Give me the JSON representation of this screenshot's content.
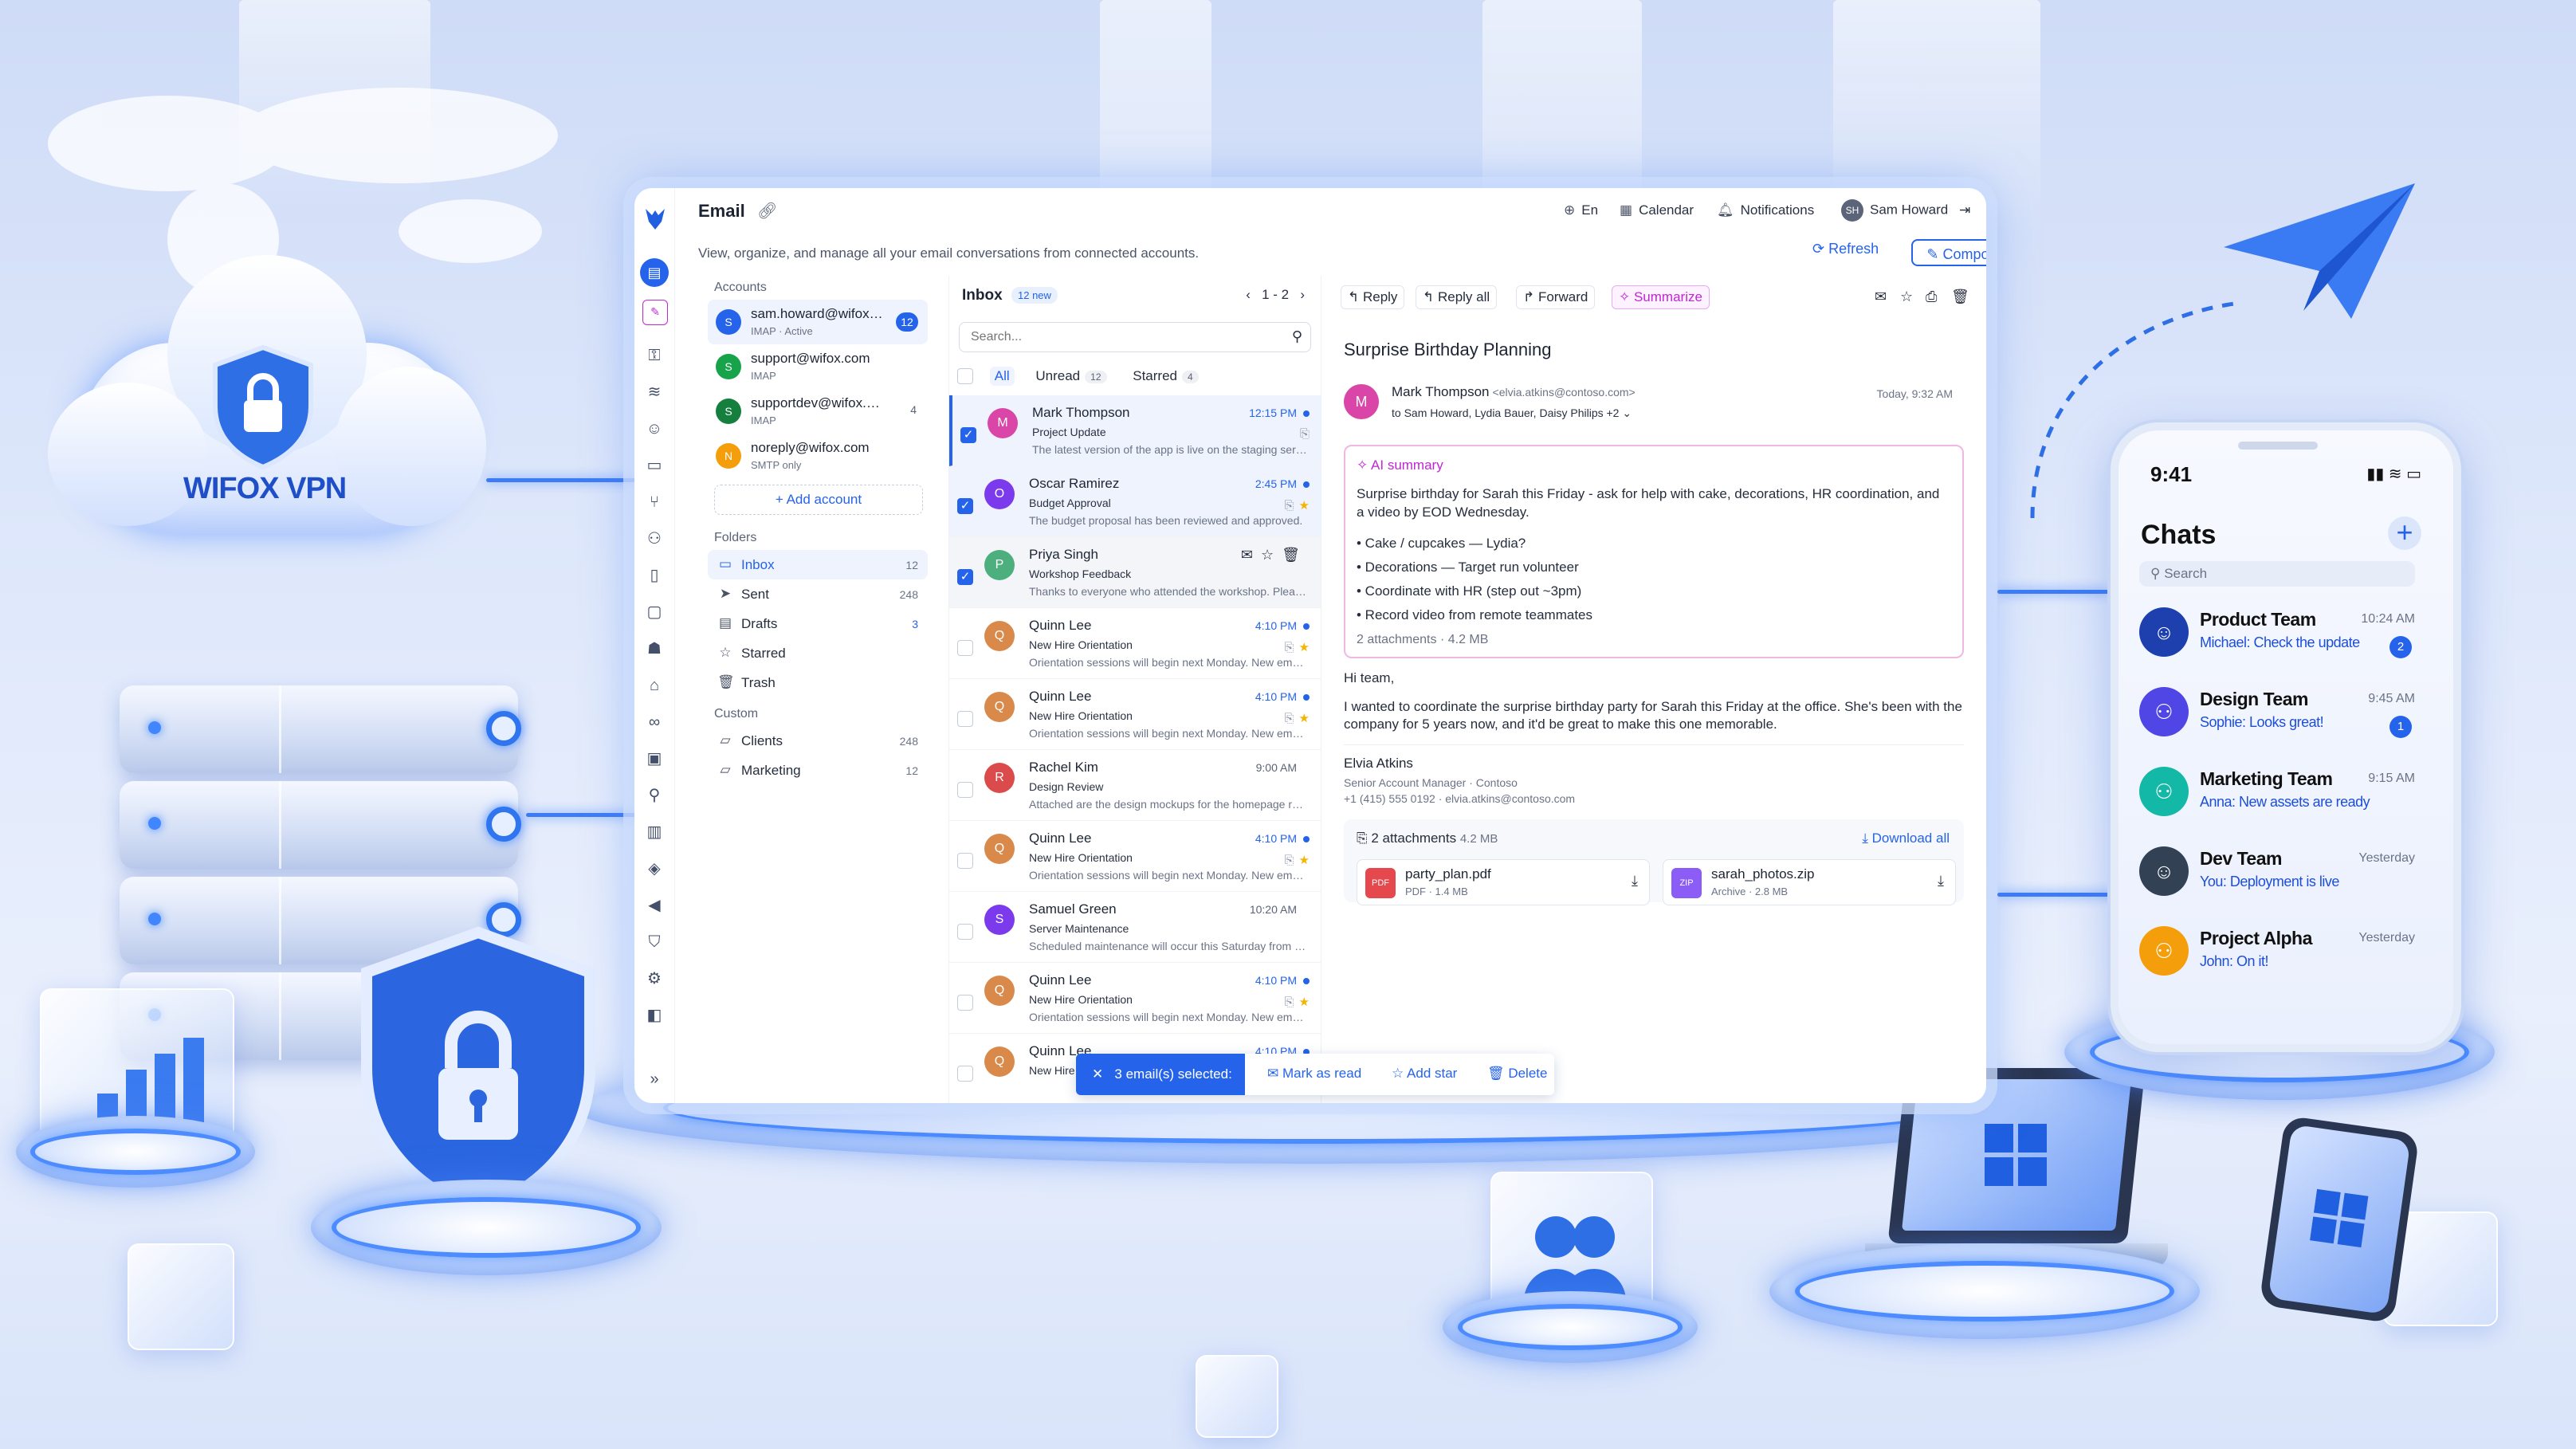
{
  "branding": {
    "vpn_logo": "WIFOX VPN"
  },
  "app": {
    "title": "Email",
    "subtitle": "View, organize, and manage all your email conversations from connected accounts.",
    "topbar": {
      "language": "En",
      "calendar": "Calendar",
      "notifications": "Notifications",
      "user_initials": "SH",
      "user_name": "Sam Howard"
    },
    "refresh_label": "Refresh",
    "compose_label": "Compose"
  },
  "accounts": {
    "heading": "Accounts",
    "items": [
      {
        "initial": "S",
        "email": "sam.howard@wifox.com",
        "sub": "IMAP · Active",
        "badge": "12",
        "color": "#2563eb"
      },
      {
        "initial": "S",
        "email": "support@wifox.com",
        "sub": "IMAP",
        "color": "#16a34a"
      },
      {
        "initial": "S",
        "email": "supportdev@wifox.com",
        "sub": "IMAP",
        "count": "4",
        "color": "#15803d"
      },
      {
        "initial": "N",
        "email": "noreply@wifox.com",
        "sub": "SMTP only",
        "color": "#f59e0b"
      }
    ],
    "add_label": "+ Add account"
  },
  "folders": {
    "heading": "Folders",
    "items": [
      {
        "label": "Inbox",
        "count": "12"
      },
      {
        "label": "Sent",
        "count": "248"
      },
      {
        "label": "Drafts",
        "count": "3"
      },
      {
        "label": "Starred",
        "count": ""
      },
      {
        "label": "Trash",
        "count": ""
      }
    ],
    "custom_heading": "Custom",
    "custom": [
      {
        "label": "Clients",
        "count": "248"
      },
      {
        "label": "Marketing",
        "count": "12"
      }
    ]
  },
  "list": {
    "title": "Inbox",
    "new_badge": "12 new",
    "pagination": "1 - 2",
    "search_placeholder": "Search...",
    "filters": {
      "all": "All",
      "unread": "Unread",
      "unread_count": "12",
      "starred": "Starred",
      "starred_count": "4"
    },
    "emails": [
      {
        "initial": "M",
        "color": "#d946a8",
        "from": "Mark Thompson",
        "subject": "Project Update",
        "preview": "The latest version of the app is live on the staging server.",
        "time": "12:15 PM",
        "unread": true,
        "checked": true
      },
      {
        "initial": "O",
        "color": "#7c3aed",
        "from": "Oscar Ramirez",
        "subject": "Budget Approval",
        "preview": "The budget proposal has been reviewed and approved.",
        "time": "2:45 PM",
        "unread": true,
        "checked": true
      },
      {
        "initial": "P",
        "color": "#4caf7d",
        "from": "Priya Singh",
        "subject": "Workshop Feedback",
        "preview": "Thanks to everyone who attended the workshop. Please share feedback.",
        "time": "",
        "unread": false,
        "checked": true
      },
      {
        "initial": "Q",
        "color": "#d98a4a",
        "from": "Quinn Lee",
        "subject": "New Hire Orientation",
        "preview": "Orientation sessions will begin next Monday. New employees welcome.",
        "time": "4:10 PM",
        "unread": true
      },
      {
        "initial": "Q",
        "color": "#d98a4a",
        "from": "Quinn Lee",
        "subject": "New Hire Orientation",
        "preview": "Orientation sessions will begin next Monday. New employees welcome.",
        "time": "4:10 PM",
        "unread": true
      },
      {
        "initial": "R",
        "color": "#dc4b4b",
        "from": "Rachel Kim",
        "subject": "Design Review",
        "preview": "Attached are the design mockups for the homepage redesign.",
        "time": "9:00 AM",
        "unread": false
      },
      {
        "initial": "Q",
        "color": "#d98a4a",
        "from": "Quinn Lee",
        "subject": "New Hire Orientation",
        "preview": "Orientation sessions will begin next Monday. New employees welcome.",
        "time": "4:10 PM",
        "unread": true
      },
      {
        "initial": "S",
        "color": "#7c3aed",
        "from": "Samuel Green",
        "subject": "Server Maintenance",
        "preview": "Scheduled maintenance will occur this Saturday from 2 AM.",
        "time": "10:20 AM",
        "unread": false
      },
      {
        "initial": "Q",
        "color": "#d98a4a",
        "from": "Quinn Lee",
        "subject": "New Hire Orientation",
        "preview": "Orientation sessions will begin next Monday. New employees welcome.",
        "time": "4:10 PM",
        "unread": true
      },
      {
        "initial": "Q",
        "color": "#d98a4a",
        "from": "Quinn Lee",
        "subject": "New Hire Orientation",
        "preview": "",
        "time": "4:10 PM",
        "unread": true
      }
    ],
    "selection_bar": {
      "label": "3 email(s) selected:",
      "mark_read": "Mark as read",
      "add_star": "Add star",
      "delete": "Delete"
    }
  },
  "reader": {
    "toolbar": {
      "reply": "Reply",
      "reply_all": "Reply all",
      "forward": "Forward",
      "summarize": "Summarize"
    },
    "subject": "Surprise Birthday Planning",
    "sender_initial": "M",
    "from_name": "Mark Thompson",
    "from_email": "<elvia.atkins@contoso.com>",
    "to": "to Sam Howard, Lydia Bauer, Daisy Philips +2 ⌄",
    "date": "Today, 9:32 AM",
    "ai_summary": {
      "heading": "AI summary",
      "paragraph": "Surprise birthday for Sarah this Friday - ask for help with cake, decorations, HR coordination, and a video by EOD Wednesday.",
      "bullets": [
        "• Cake / cupcakes — Lydia?",
        "• Decorations — Target run volunteer",
        "• Coordinate with HR (step out ~3pm)",
        "• Record video from remote teammates"
      ],
      "footer": "2 attachments · 4.2 MB"
    },
    "greeting": "Hi team,",
    "body": "I wanted to coordinate the surprise birthday party for Sarah this Friday at the office. She's been with the company for 5 years now, and it'd be great to make this one memorable.",
    "signature": {
      "name": "Elvia Atkins",
      "title": "Senior Account Manager · Contoso",
      "contact": "+1 (415) 555 0192 · elvia.atkins@contoso.com"
    },
    "attachments": {
      "heading": "2 attachments",
      "size": "4.2 MB",
      "download_all": "Download all",
      "files": [
        {
          "badge": "PDF",
          "name": "party_plan.pdf",
          "meta": "PDF · 1.4 MB",
          "color": "#e5484d"
        },
        {
          "badge": "ZIP",
          "name": "sarah_photos.zip",
          "meta": "Archive · 2.8 MB",
          "color": "#8b5cf6"
        }
      ]
    }
  },
  "phone": {
    "time": "9:41",
    "title": "Chats",
    "search_placeholder": "Search",
    "chats": [
      {
        "name": "Product Team",
        "message": "Michael: Check the update",
        "time": "10:24 AM",
        "badge": "2",
        "color": "#1e40af",
        "icon": "person"
      },
      {
        "name": "Design Team",
        "message": "Sophie: Looks great!",
        "time": "9:45 AM",
        "badge": "1",
        "color": "#4f46e5",
        "icon": "group"
      },
      {
        "name": "Marketing Team",
        "message": "Anna: New assets are ready",
        "time": "9:15 AM",
        "badge": "",
        "color": "#14b8a6",
        "icon": "group"
      },
      {
        "name": "Dev Team",
        "message": "You: Deployment is live",
        "time": "Yesterday",
        "badge": "",
        "color": "#334155",
        "icon": "person"
      },
      {
        "name": "Project Alpha",
        "message": "John: On it!",
        "time": "Yesterday",
        "badge": "",
        "color": "#f59e0b",
        "icon": "group"
      }
    ]
  }
}
